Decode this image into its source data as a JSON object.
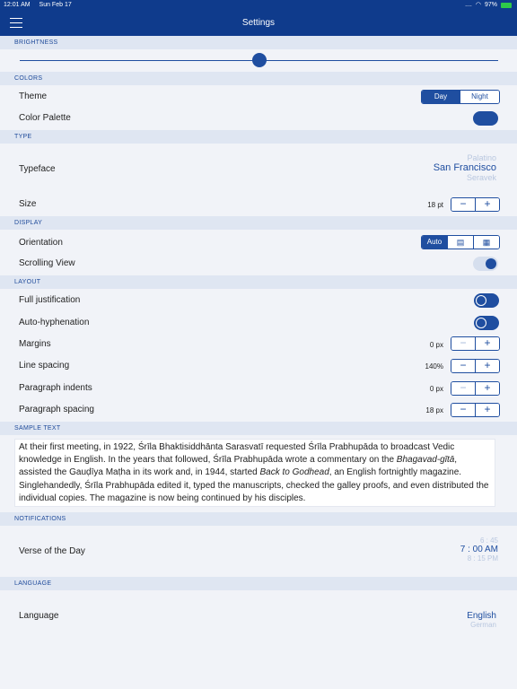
{
  "status_bar": {
    "time": "12:01 AM",
    "date": "Sun Feb 17",
    "signal": "....",
    "battery_percent": "97%"
  },
  "nav": {
    "title": "Settings",
    "menu_icon": "hamburger-menu-icon"
  },
  "sections": {
    "brightness": "BRIGHTNESS",
    "colors": "COLORS",
    "type": "TYPE",
    "display": "DISPLAY",
    "layout": "LAYOUT",
    "sample_text": "SAMPLE TEXT",
    "notifications": "NOTIFICATIONS",
    "language": "LANGUAGE"
  },
  "brightness": {
    "level": 0.5
  },
  "colors": {
    "theme_label": "Theme",
    "theme_options": [
      "Day",
      "Night"
    ],
    "theme_selected": "Day",
    "palette_label": "Color Palette",
    "accent": "#1f4ea0"
  },
  "type": {
    "typeface_label": "Typeface",
    "typeface_above": "Palatino",
    "typeface_selected": "San Francisco",
    "typeface_below": "Seravek",
    "size_label": "Size",
    "size_value": "18 pt"
  },
  "display": {
    "orientation_label": "Orientation",
    "orientation_options": [
      "Auto",
      "portrait-icon",
      "landscape-icon"
    ],
    "orientation_selected": "Auto",
    "scrolling_label": "Scrolling View",
    "scrolling_on": true
  },
  "layout": {
    "full_justification_label": "Full justification",
    "auto_hyphenation_label": "Auto-hyphenation",
    "margins_label": "Margins",
    "margins_value": "0 px",
    "line_spacing_label": "Line spacing",
    "line_spacing_value": "140%",
    "paragraph_indents_label": "Paragraph indents",
    "paragraph_indents_value": "0 px",
    "paragraph_spacing_label": "Paragraph spacing",
    "paragraph_spacing_value": "18 px"
  },
  "sample": {
    "part1": "At their first meeting, in 1922, Śrīla Bhaktisiddhānta Sarasvatī requested Śrīla Prabhupāda to broadcast Vedic knowledge in English. In the years that followed, Śrīla Prabhupāda wrote a commentary on the ",
    "italic1": "Bhagavad-gītā",
    "part2": ", assisted the Gauḍīya Maṭha in its work and, in 1944, started ",
    "italic2": "Back to Godhead",
    "part3": ", an English fortnightly magazine. Singlehandedly, Śrīla Prabhupāda edited it, typed the manuscripts, checked the galley proofs, and even distributed the individual copies. The magazine is now being continued by his disciples."
  },
  "notifications": {
    "verse_label": "Verse of the Day",
    "time_above": "6 : 45",
    "time_selected": "7 : 00 AM",
    "time_below": "8 : 15 PM"
  },
  "language": {
    "label": "Language",
    "selected": "English",
    "below": "German"
  }
}
